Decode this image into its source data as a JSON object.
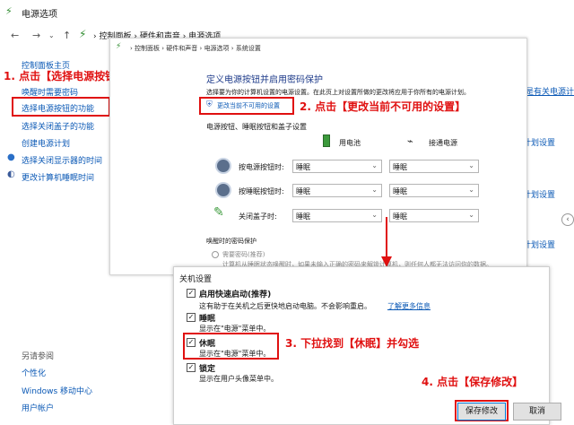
{
  "window": {
    "title": "电源选项"
  },
  "breadcrumb": {
    "item1": "控制面板",
    "item2": "硬件和声音",
    "item3": "电源选项"
  },
  "inner_breadcrumb": {
    "item1": "控制面板",
    "item2": "硬件和声音",
    "item3": "电源选项",
    "item4": "系统设置"
  },
  "sidebar": {
    "home": "控制面板主页",
    "items": [
      "唤醒时需要密码",
      "选择电源按钮的功能",
      "选择关闭盖子的功能",
      "创建电源计划",
      "选择关闭显示器的时间",
      "更改计算机睡眠时间"
    ],
    "see_also": "另请参阅",
    "links": [
      "个性化",
      "Windows 移动中心",
      "用户帐户"
    ]
  },
  "right_links": [
    "是有关电源计",
    "计划设置",
    "计划设置",
    "计划设置"
  ],
  "dialog": {
    "heading": "定义电源按钮并启用密码保护",
    "desc": "选择要为你的计算机设置的电源设置。在此页上对设置所做的更改将应用于你所有的电源计划。",
    "unavailable_link": "更改当前不可用的设置",
    "section": "电源按钮、睡眠按钮和盖子设置",
    "col_battery": "用电池",
    "col_plugged": "接通电源",
    "rows": [
      {
        "label": "按电源按钮时:",
        "battery": "睡眠",
        "plugged": "睡眠"
      },
      {
        "label": "按睡眠按钮时:",
        "battery": "睡眠",
        "plugged": "睡眠"
      },
      {
        "label": "关闭盖子时:",
        "battery": "睡眠",
        "plugged": "睡眠"
      }
    ],
    "pw_section": "唤醒时的密码保护",
    "pw_option": "需要密码(推荐)",
    "pw_desc": "计算机从睡眠状态唤醒时，如果未输入正确的密码来解锁计算机，则任何人都无法访问你的数据。"
  },
  "shutdown": {
    "title": "关机设置",
    "items": [
      {
        "label": "启用快速启动(推荐)",
        "desc": "这有助于在关机之后更快地启动电脑。不会影响重启。",
        "link": "了解更多信息",
        "checked": true
      },
      {
        "label": "睡眠",
        "desc": "显示在\"电源\"菜单中。",
        "checked": true
      },
      {
        "label": "休眠",
        "desc": "显示在\"电源\"菜单中。",
        "checked": true
      },
      {
        "label": "锁定",
        "desc": "显示在用户头像菜单中。",
        "checked": true
      }
    ],
    "save": "保存修改",
    "cancel": "取消"
  },
  "annotations": {
    "step1": "1. 点击【选择电源按钮的功能】",
    "step2": "2. 点击【更改当前不可用的设置】",
    "step3": "3. 下拉找到【休眠】并勾选",
    "step4": "4. 点击【保存修改】"
  },
  "colors": {
    "annotation": "#e01010",
    "link": "#0a58b5"
  }
}
